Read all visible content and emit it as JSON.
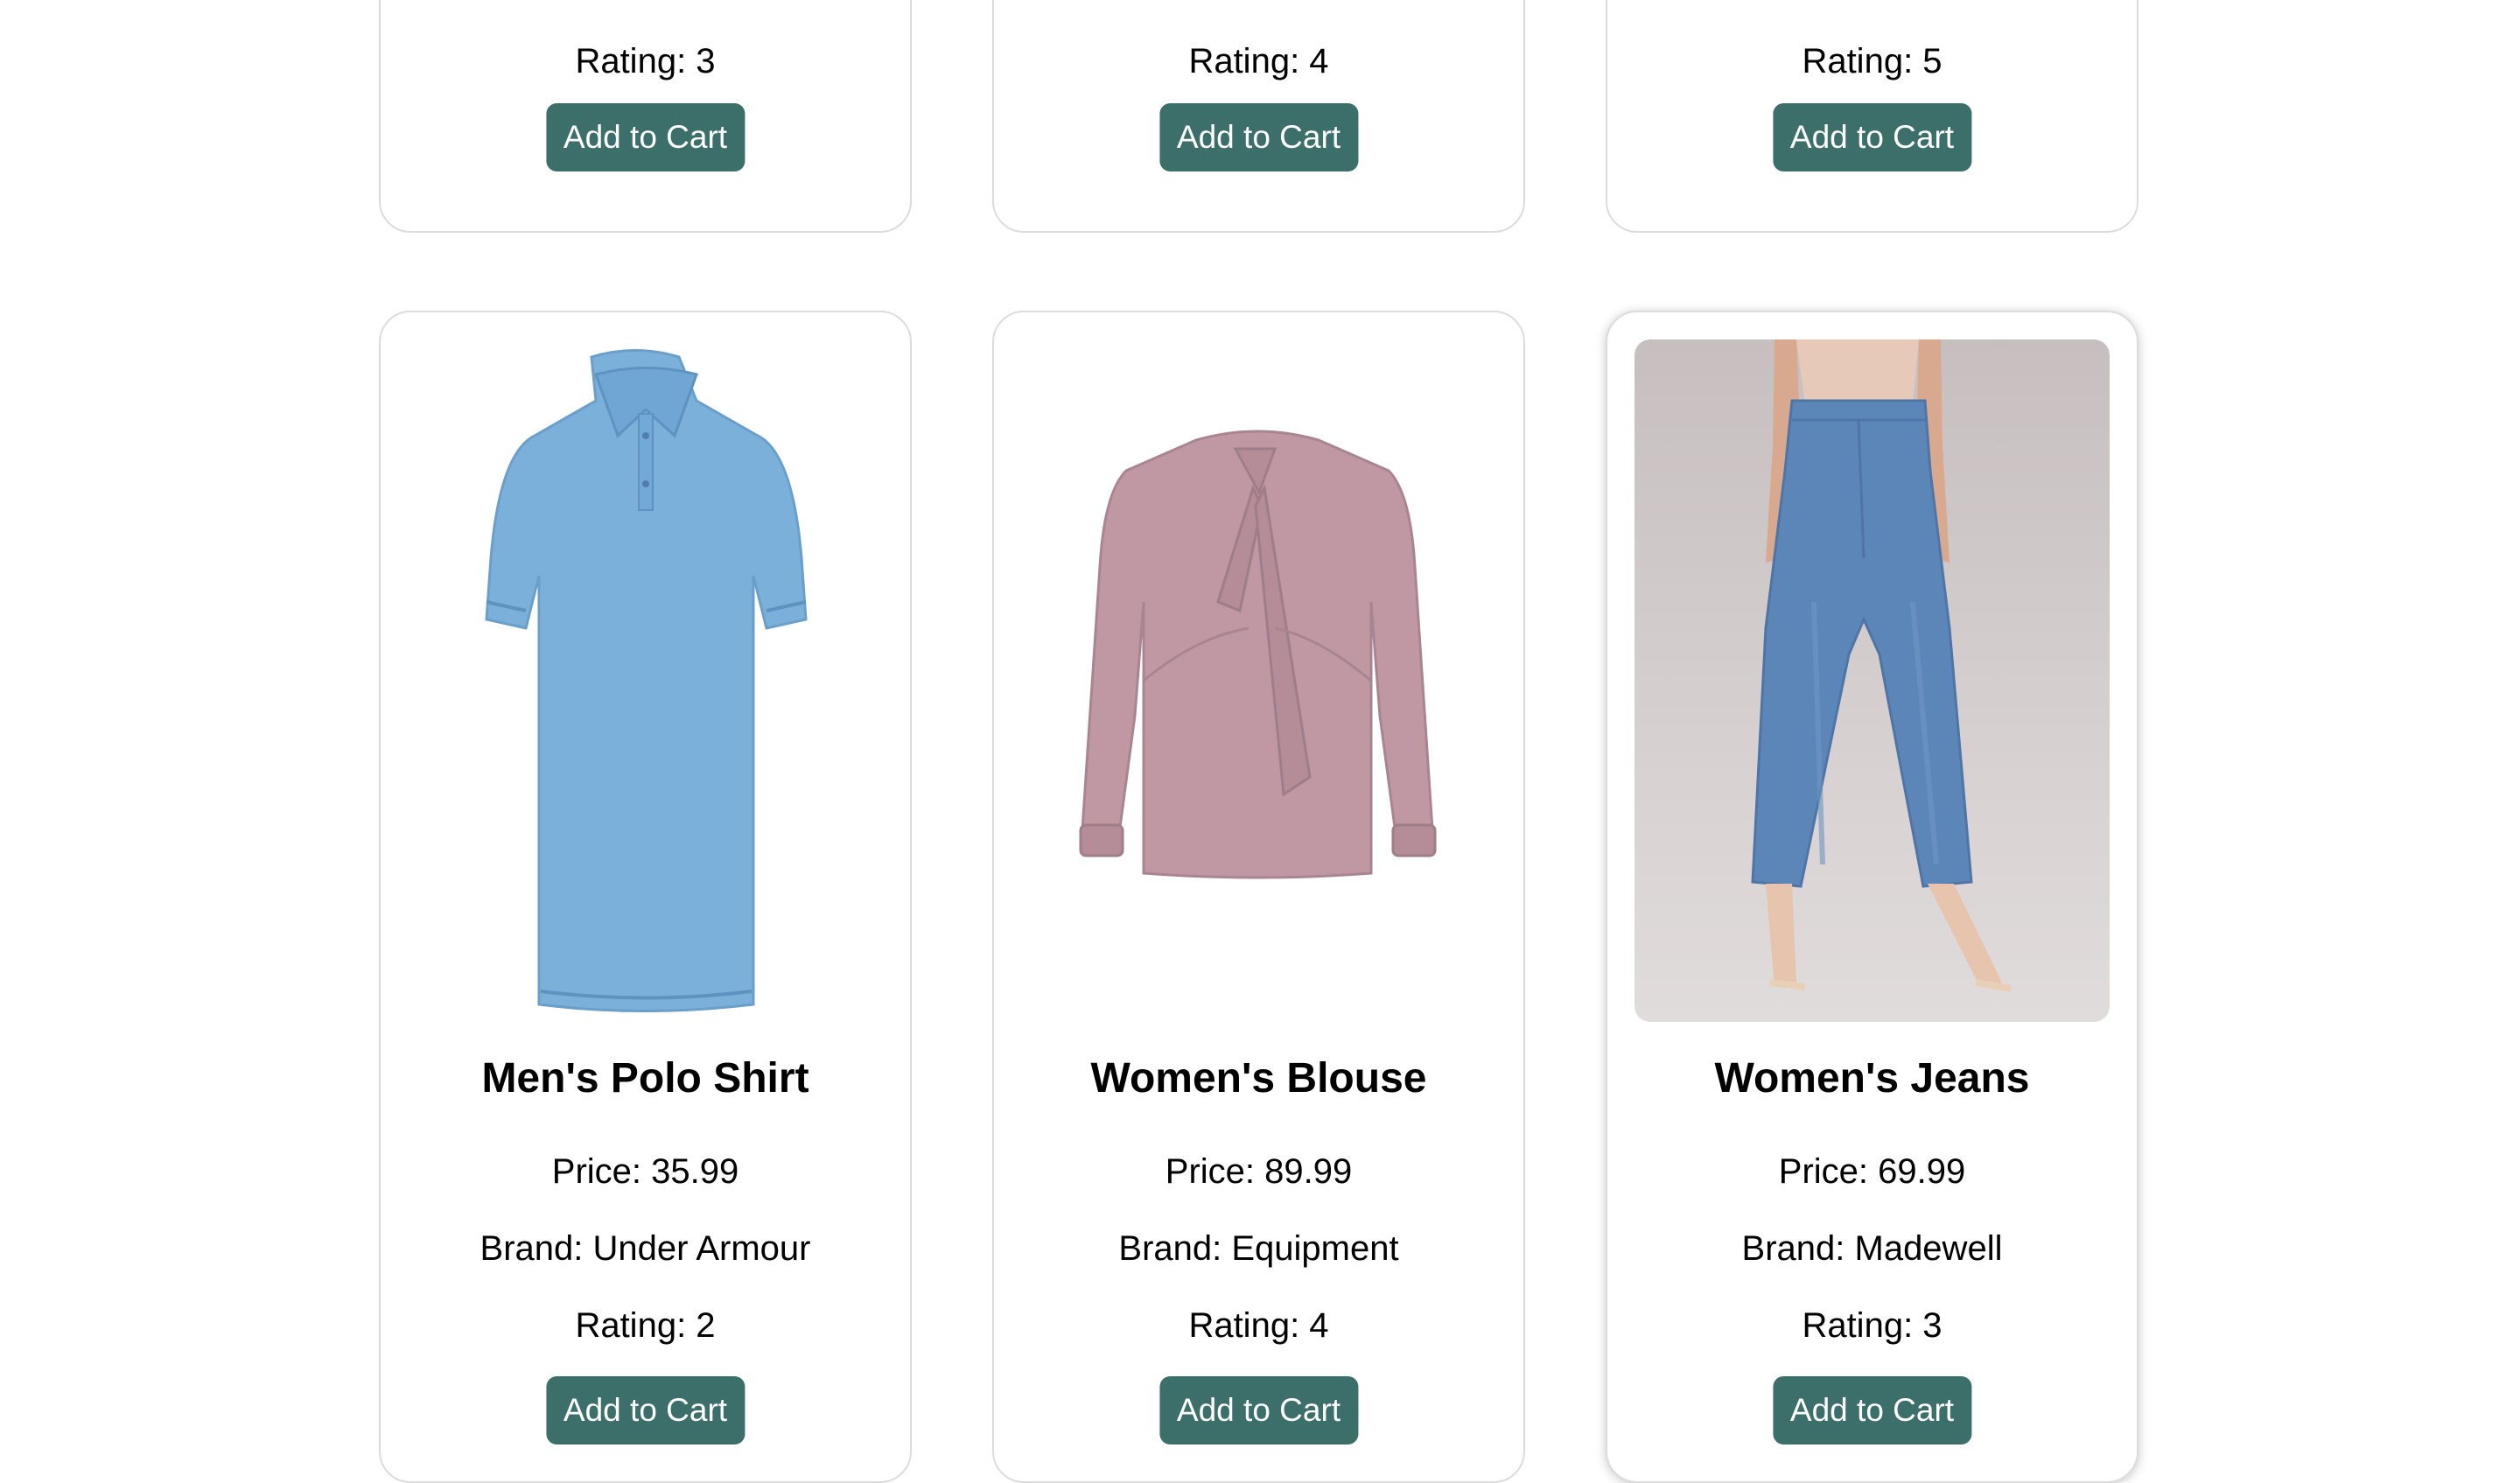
{
  "products_top": [
    {
      "rating": "Rating: 3",
      "button": "Add to Cart"
    },
    {
      "rating": "Rating: 4",
      "button": "Add to Cart"
    },
    {
      "rating": "Rating: 5",
      "button": "Add to Cart"
    }
  ],
  "products": [
    {
      "image_icon": "polo-shirt-image",
      "name": "Men's Polo Shirt",
      "price": "Price: 35.99",
      "brand": "Brand: Under Armour",
      "rating": "Rating: 2",
      "button": "Add to Cart",
      "color": "#7bb0db"
    },
    {
      "image_icon": "blouse-image",
      "name": "Women's Blouse",
      "price": "Price: 89.99",
      "brand": "Brand: Equipment",
      "rating": "Rating: 4",
      "button": "Add to Cart",
      "color": "#bf98a4"
    },
    {
      "image_icon": "jeans-image",
      "name": "Women's Jeans",
      "price": "Price: 69.99",
      "brand": "Brand: Madewell",
      "rating": "Rating: 3",
      "button": "Add to Cart",
      "color": "#5d86b8"
    }
  ],
  "colors": {
    "button_bg": "#3c6e6a",
    "button_text": "#ffffff",
    "card_border": "#dcdcdc"
  }
}
